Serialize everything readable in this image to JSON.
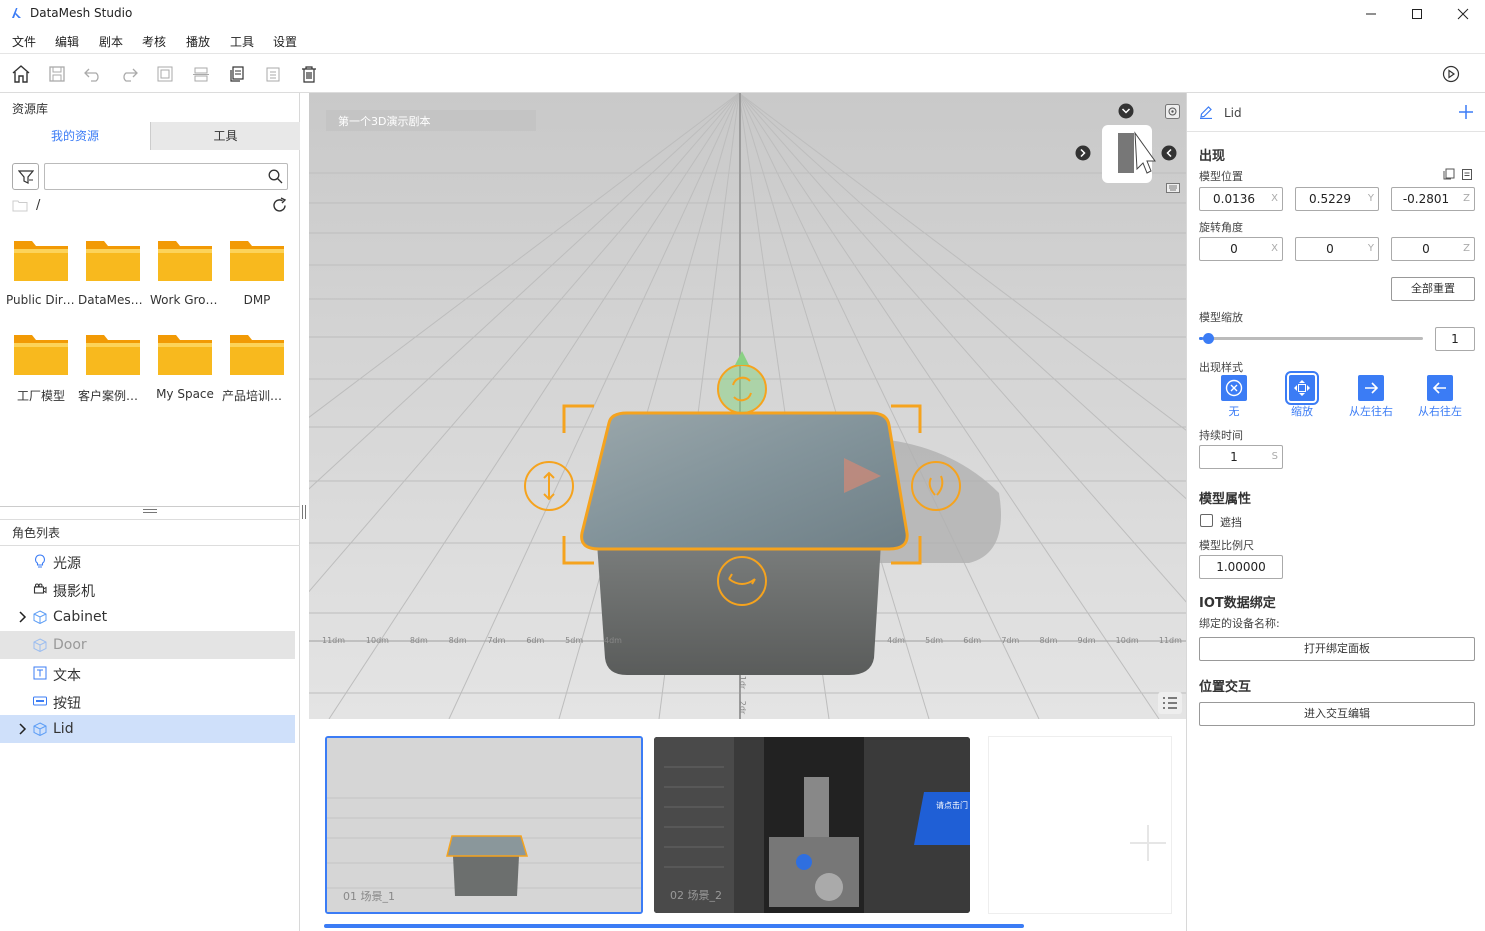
{
  "app": {
    "title": "DataMesh Studio"
  },
  "menu": [
    "文件",
    "编辑",
    "剧本",
    "考核",
    "播放",
    "工具",
    "设置"
  ],
  "left": {
    "library_title": "资源库",
    "tabs": [
      "我的资源",
      "工具"
    ],
    "search_placeholder": "",
    "path": "/",
    "folders": [
      "Public Dire…",
      "DataMesh …",
      "Work Group",
      "DMP",
      "工厂模型",
      "客户案例合集",
      "My Space",
      "产品培训小组"
    ],
    "roles_title": "角色列表",
    "roles": [
      "光源",
      "摄影机",
      "Cabinet",
      "Door",
      "文本",
      "按钮",
      "Lid"
    ]
  },
  "viewport": {
    "scene_label": "第一个3D演示剧本",
    "ruler_left": [
      "11dm",
      "10dm",
      "8dm",
      "8dm",
      "7dm",
      "6dm",
      "5dm",
      "4dm"
    ],
    "ruler_right": [
      "4dm",
      "5dm",
      "6dm",
      "7dm",
      "8dm",
      "9dm",
      "10dm",
      "11dm"
    ],
    "ruler_vertical": [
      "1dr",
      "2dr"
    ]
  },
  "filmstrip": {
    "scenes": [
      {
        "label": "01   场景_1"
      },
      {
        "label": "02   场景_2"
      }
    ],
    "sign_text": "请点击门"
  },
  "right": {
    "object_name": "Lid",
    "appear_title": "出现",
    "position_label": "模型位置",
    "position": {
      "x": "0.0136",
      "y": "0.5229",
      "z": "-0.2801"
    },
    "rotation_label": "旋转角度",
    "rotation": {
      "x": "0",
      "y": "0",
      "z": "0"
    },
    "axis": {
      "x": "X",
      "y": "Y",
      "z": "Z"
    },
    "reset_all": "全部重置",
    "scale_label": "模型缩放",
    "scale_value": "1",
    "scale_fraction": 0.02,
    "style_label": "出现样式",
    "styles": [
      "无",
      "缩放",
      "从左往右",
      "从右往左"
    ],
    "duration_label": "持续时间",
    "duration_value": "1",
    "duration_unit": "S",
    "props_title": "模型属性",
    "occlude_label": "遮挡",
    "ratio_label": "模型比例尺",
    "ratio_value": "1.00000",
    "iot_title": "IOT数据绑定",
    "iot_device_label": "绑定的设备名称:",
    "iot_button": "打开绑定面板",
    "interact_title": "位置交互",
    "interact_button": "进入交互编辑"
  },
  "colors": {
    "accent": "#3b7cf5",
    "folder": "#f5b014",
    "gizmo": "#f5a31e",
    "selected_row": "#cfe0fa"
  }
}
